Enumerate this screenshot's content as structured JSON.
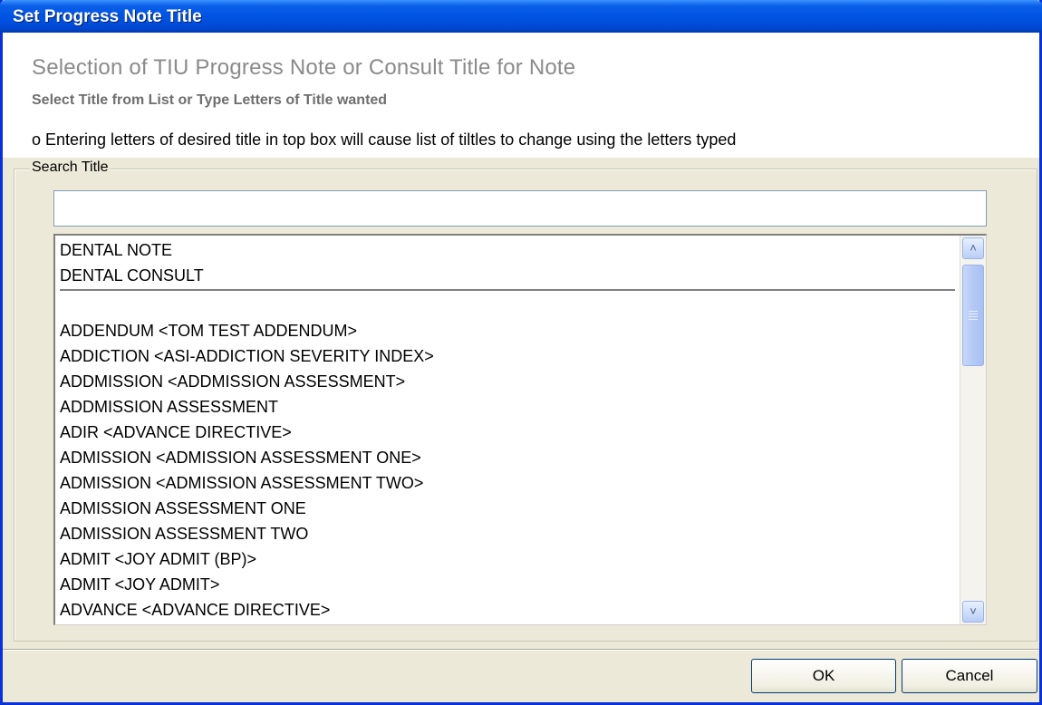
{
  "window": {
    "title": "Set Progress Note Title"
  },
  "header": {
    "heading": "Selection of TIU Progress Note or Consult Title for Note",
    "subheading": "Select Title from List or Type Letters of Title wanted",
    "instruction": "o Entering letters of desired title in top box will cause list of tiltles to change using the letters typed"
  },
  "search": {
    "group_label": "Search Title",
    "value": ""
  },
  "list": {
    "pinned_items": [
      "DENTAL NOTE",
      "DENTAL CONSULT"
    ],
    "items": [
      "ADDENDUM  <TOM TEST ADDENDUM>",
      "ADDICTION  <ASI-ADDICTION SEVERITY INDEX>",
      "ADDMISSION  <ADDMISSION ASSESSMENT>",
      "ADDMISSION ASSESSMENT",
      "ADIR  <ADVANCE DIRECTIVE>",
      "ADMISSION  <ADMISSION ASSESSMENT ONE>",
      "ADMISSION  <ADMISSION ASSESSMENT TWO>",
      "ADMISSION ASSESSMENT ONE",
      "ADMISSION ASSESSMENT TWO",
      "ADMIT  <JOY ADMIT (BP)>",
      "ADMIT  <JOY ADMIT>",
      "ADVANCE  <ADVANCE DIRECTIVE>"
    ],
    "scroll_up_icon": "chevron-up-icon",
    "scroll_down_icon": "chevron-down-icon"
  },
  "buttons": {
    "ok_label": "OK",
    "cancel_label": "Cancel"
  },
  "colors": {
    "titlebar": "#0054e3",
    "dialog_background": "#ece9d8"
  }
}
